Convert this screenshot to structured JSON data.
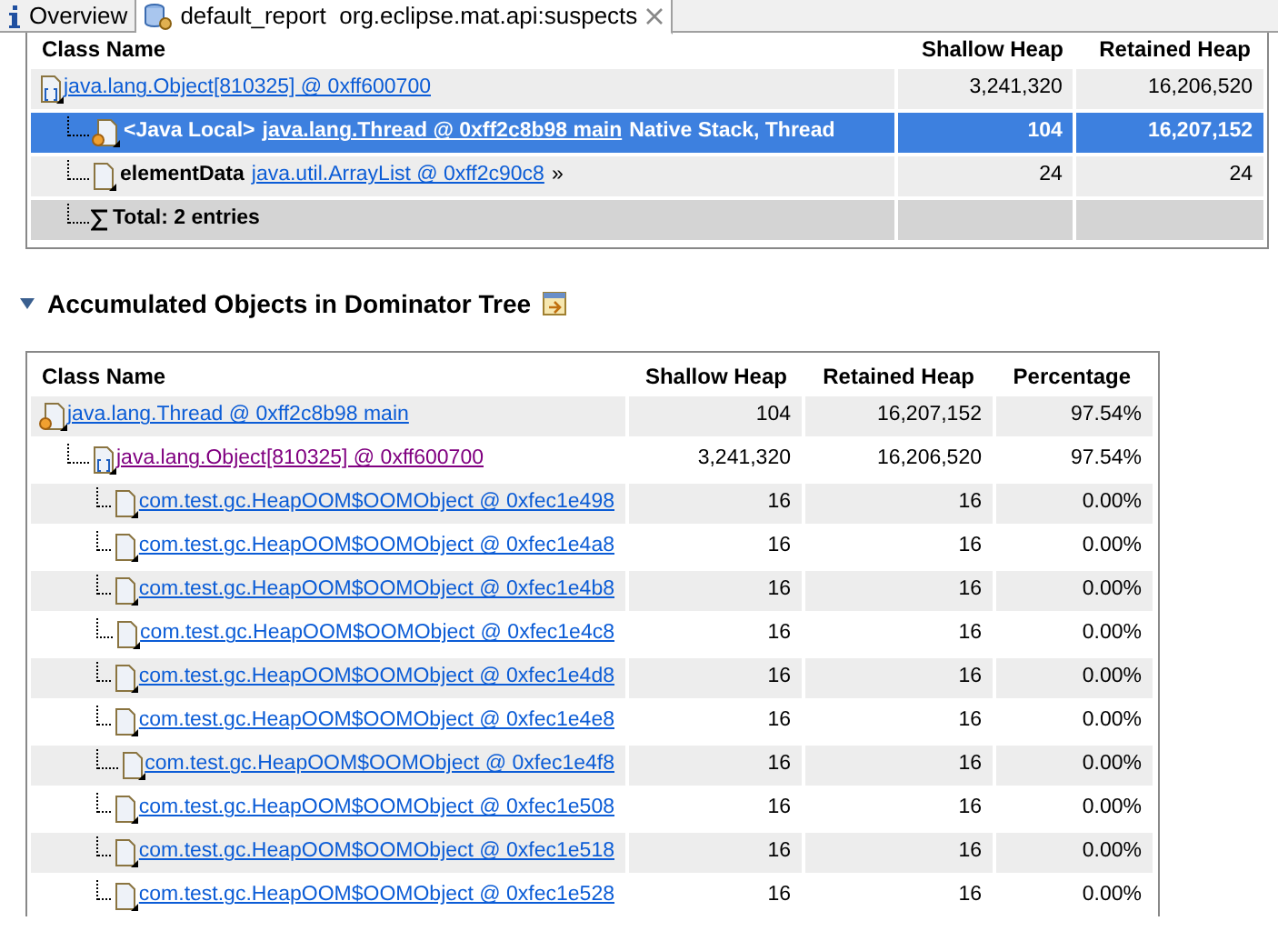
{
  "tabs": [
    {
      "label": "Overview",
      "kind": "info",
      "selected": false,
      "closable": false
    },
    {
      "label": "default_report  org.eclipse.mat.api:suspects",
      "kind": "report",
      "selected": true,
      "closable": true
    }
  ],
  "table_1": {
    "columns": [
      "Class Name",
      "Shallow Heap",
      "Retained Heap"
    ],
    "rows": [
      {
        "kind": "array",
        "link": "java.lang.Object[810325] @ 0xff600700",
        "visited": false,
        "selected": false,
        "values": [
          "3,241,320",
          "16,206,520"
        ],
        "children": [
          {
            "kind": "thread",
            "prefix": "<Java Local>",
            "link": "java.lang.Thread @ 0xff2c8b98 main",
            "suffix": "Native Stack, Thread",
            "visited": false,
            "selected": true,
            "values": [
              "104",
              "16,207,152"
            ]
          },
          {
            "kind": "object",
            "prefix": "elementData",
            "link": "java.util.ArrayList @ 0xff2c90c8",
            "suffix": "»",
            "visited": false,
            "selected": false,
            "values": [
              "24",
              "24"
            ]
          },
          {
            "kind": "total",
            "prefix": "Total: 2 entries",
            "selected": false
          }
        ]
      }
    ]
  },
  "section": {
    "title": "Accumulated Objects in Dominator Tree",
    "expanded": true
  },
  "table_2": {
    "columns": [
      "Class Name",
      "Shallow Heap",
      "Retained Heap",
      "Percentage"
    ],
    "rows": [
      {
        "kind": "thread",
        "link": "java.lang.Thread @ 0xff2c8b98 main",
        "visited": false,
        "selected": false,
        "values": [
          "104",
          "16,207,152",
          "97.54%"
        ],
        "children": [
          {
            "kind": "array",
            "link": "java.lang.Object[810325] @ 0xff600700",
            "visited": true,
            "selected": false,
            "values": [
              "3,241,320",
              "16,206,520",
              "97.54%"
            ],
            "children": [
              {
                "kind": "object",
                "link": "com.test.gc.HeapOOM$OOMObject @ 0xfec1e498",
                "visited": false,
                "selected": false,
                "values": [
                  "16",
                  "16",
                  "0.00%"
                ]
              },
              {
                "kind": "object",
                "link": "com.test.gc.HeapOOM$OOMObject @ 0xfec1e4a8",
                "visited": false,
                "selected": false,
                "values": [
                  "16",
                  "16",
                  "0.00%"
                ]
              },
              {
                "kind": "object",
                "link": "com.test.gc.HeapOOM$OOMObject @ 0xfec1e4b8",
                "visited": false,
                "selected": false,
                "values": [
                  "16",
                  "16",
                  "0.00%"
                ]
              },
              {
                "kind": "object",
                "link": "com.test.gc.HeapOOM$OOMObject @ 0xfec1e4c8",
                "visited": false,
                "selected": false,
                "values": [
                  "16",
                  "16",
                  "0.00%"
                ]
              },
              {
                "kind": "object",
                "link": "com.test.gc.HeapOOM$OOMObject @ 0xfec1e4d8",
                "visited": false,
                "selected": false,
                "values": [
                  "16",
                  "16",
                  "0.00%"
                ]
              },
              {
                "kind": "object",
                "link": "com.test.gc.HeapOOM$OOMObject @ 0xfec1e4e8",
                "visited": false,
                "selected": false,
                "values": [
                  "16",
                  "16",
                  "0.00%"
                ]
              },
              {
                "kind": "object",
                "link": "com.test.gc.HeapOOM$OOMObject @ 0xfec1e4f8",
                "visited": false,
                "selected": false,
                "values": [
                  "16",
                  "16",
                  "0.00%"
                ]
              },
              {
                "kind": "object",
                "link": "com.test.gc.HeapOOM$OOMObject @ 0xfec1e508",
                "visited": false,
                "selected": false,
                "values": [
                  "16",
                  "16",
                  "0.00%"
                ]
              },
              {
                "kind": "object",
                "link": "com.test.gc.HeapOOM$OOMObject @ 0xfec1e518",
                "visited": false,
                "selected": false,
                "values": [
                  "16",
                  "16",
                  "0.00%"
                ]
              },
              {
                "kind": "object",
                "link": "com.test.gc.HeapOOM$OOMObject @ 0xfec1e528",
                "visited": false,
                "selected": false,
                "values": [
                  "16",
                  "16",
                  "0.00%"
                ]
              }
            ]
          }
        ]
      }
    ]
  }
}
